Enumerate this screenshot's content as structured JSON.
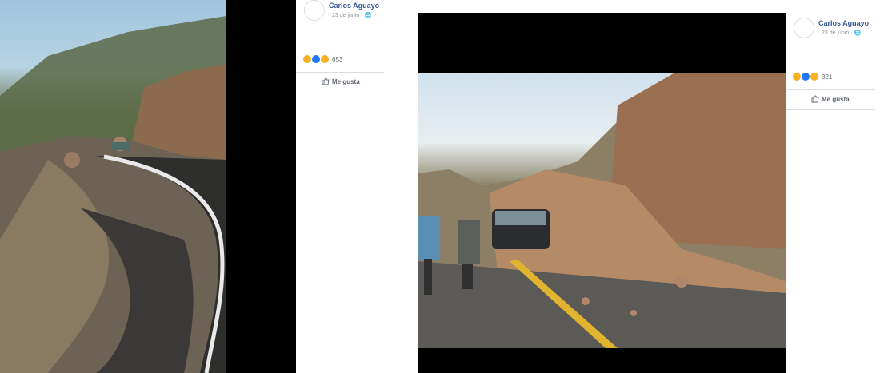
{
  "left_post": {
    "author": "Carlos Aguayo",
    "date": "23 de junio · ",
    "reactions_count": "653",
    "like_label": "Me gusta"
  },
  "right_post": {
    "author": "Carlos Aguayo",
    "date": "23 de junio · ",
    "reactions_count": "321",
    "like_label": "Me gusta"
  },
  "colors": {
    "author_link": "#385898",
    "meta_text": "#90949c",
    "viewer_bg": "#000000"
  },
  "icons": [
    "globe-icon",
    "sad-reaction-icon",
    "like-reaction-icon",
    "wow-reaction-icon",
    "thumbs-up-icon"
  ]
}
